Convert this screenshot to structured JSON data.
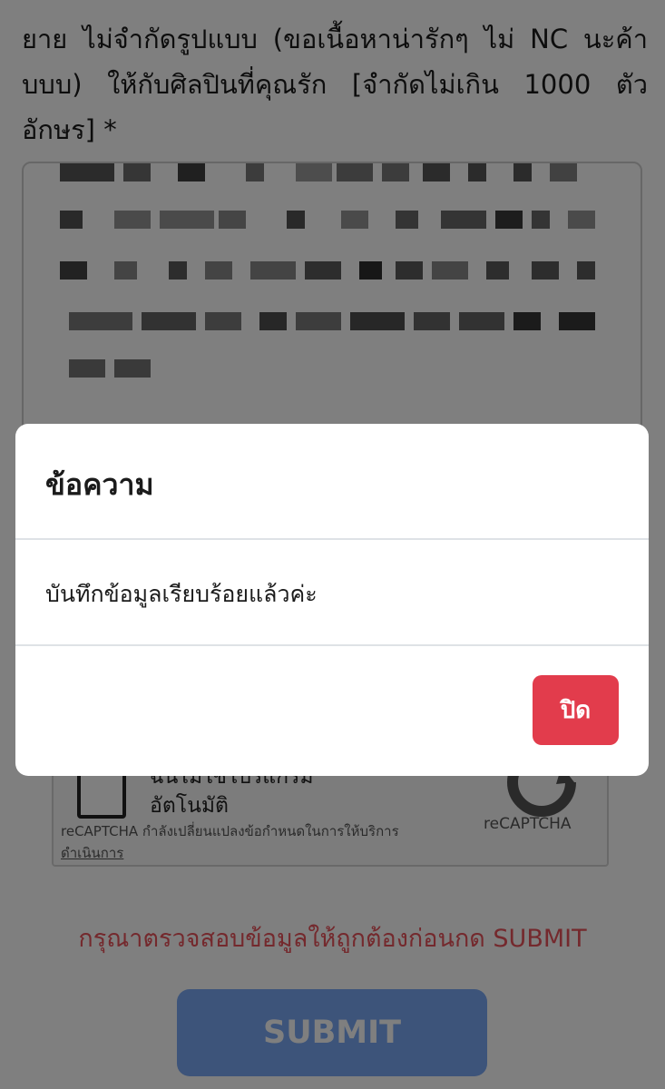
{
  "form": {
    "question_text": "ยาย ไม่จำกัดรูปแบบ (ขอเนื้อหาน่ารักๆ ไม่ NC นะค้าบบบ) ให้กับศิลปินที่คุณรัก [จำกัดไม่เกิน 1000 ตัวอักษร] *",
    "answer_value": "",
    "recaptcha": {
      "label": "ฉันไม่ใช่โปรแกรมอัตโนมัติ",
      "brand": "reCAPTCHA",
      "terms_text": "reCAPTCHA กำลังเปลี่ยนแปลงข้อกำหนดในการให้บริการ",
      "terms_link": "ดำเนินการ",
      "icon": "recaptcha-logo-icon"
    },
    "warning_text": "กรุณาตรวจสอบข้อมูลให้ถูกต้องก่อนกด SUBMIT",
    "submit_label": "SUBMIT"
  },
  "modal": {
    "title": "ข้อความ",
    "message": "บันทึกข้อมูลเรียบร้อยแล้วค่ะ",
    "close_label": "ปิด"
  },
  "colors": {
    "overlay": "rgba(0,0,0,0.5)",
    "close_button": "#e23c4c",
    "warning_text": "#e8525b",
    "submit_button": "#7aa8f4"
  }
}
